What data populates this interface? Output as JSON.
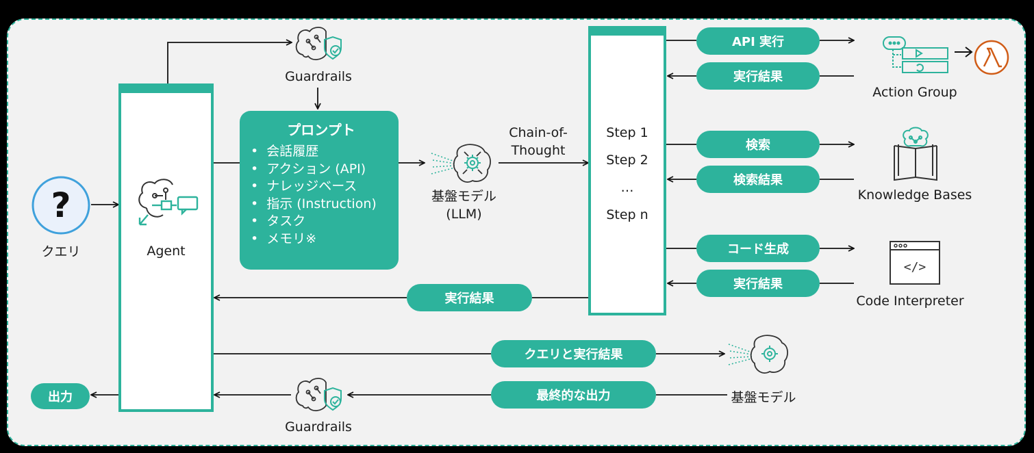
{
  "query": {
    "symbol": "?",
    "label": "クエリ"
  },
  "agent": {
    "label": "Agent"
  },
  "guardrails_top": {
    "label": "Guardrails"
  },
  "guardrails_bottom": {
    "label": "Guardrails"
  },
  "prompt": {
    "title": "プロンプト",
    "items": [
      "会話履歴",
      "アクション (API)",
      "ナレッジベース",
      "指示 (Instruction)",
      "タスク",
      "メモリ※"
    ]
  },
  "llm": {
    "label_line1": "基盤モデル",
    "label_line2": "(LLM)"
  },
  "cot": {
    "line1": "Chain-of-",
    "line2": "Thought"
  },
  "steps": [
    "Step 1",
    "Step 2",
    "…",
    "Step n"
  ],
  "pills": {
    "api_exec": "API 実行",
    "exec_result_1": "実行結果",
    "search": "検索",
    "search_result": "検索結果",
    "code_gen": "コード生成",
    "exec_result_2": "実行結果",
    "exec_result_back": "実行結果",
    "query_and_result": "クエリと実行結果",
    "final_output": "最終的な出力",
    "output": "出力"
  },
  "targets": {
    "action_group": "Action Group",
    "knowledge_bases": "Knowledge Bases",
    "code_interpreter": "Code Interpreter",
    "foundation_model": "基盤モデル",
    "code_icon_text": "</>"
  },
  "colors": {
    "accent": "#2db39c",
    "lambda": "#d05c17",
    "panel_bg": "#f2f2f2"
  }
}
